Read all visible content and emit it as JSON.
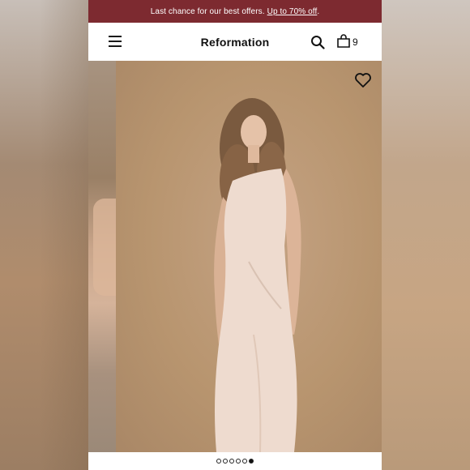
{
  "promo": {
    "text": "Last chance for our best offers.",
    "link": "Up to 70% off",
    "suffix": "."
  },
  "header": {
    "brand": "Reformation",
    "bag_count": "9",
    "icons": [
      "menu-icon",
      "search-icon",
      "bag-icon",
      "heart-icon"
    ]
  },
  "gallery": {
    "slide_count": 6,
    "active_slide": 6
  },
  "colors": {
    "promo_bg": "#7d2a30",
    "dress": "#eedbcf",
    "backdrop": "#b8956f"
  }
}
